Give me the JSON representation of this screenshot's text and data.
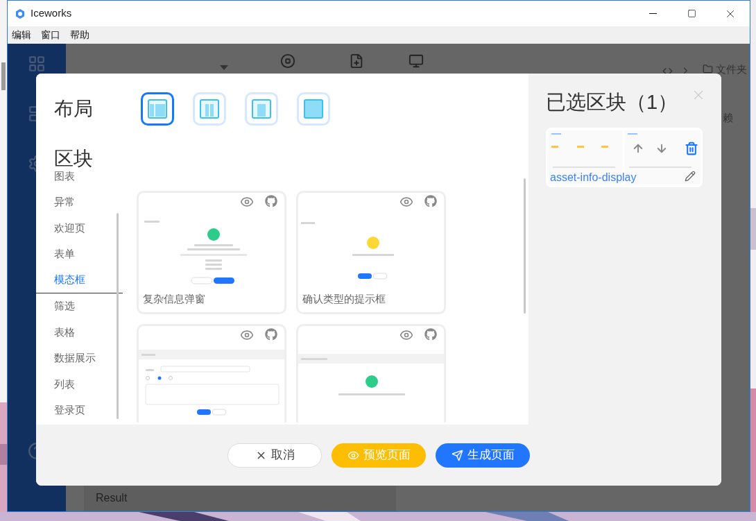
{
  "window": {
    "title": "Iceworks"
  },
  "menu": [
    "编辑",
    "窗口",
    "帮助"
  ],
  "background_app": {
    "sidebar": [
      {
        "kind": "grid"
      },
      {
        "kind": "template"
      },
      {
        "kind": "gear"
      },
      {
        "kind": "help"
      }
    ],
    "tools": [
      {
        "kind": "code"
      },
      {
        "kind": "terminal"
      },
      {
        "kind": "folder",
        "label": "文件夹"
      }
    ],
    "side_text": "赖",
    "result": "Result"
  },
  "dialog": {
    "layout_title": "布局",
    "layouts": [
      {
        "kind": "sidebar-left",
        "selected": true
      },
      {
        "kind": "two-column",
        "selected": false
      },
      {
        "kind": "centered",
        "selected": false
      },
      {
        "kind": "full",
        "selected": false
      }
    ],
    "blocks_title": "区块",
    "categories": [
      {
        "label": "图表",
        "selected": false
      },
      {
        "label": "异常",
        "selected": false
      },
      {
        "label": "欢迎页",
        "selected": false
      },
      {
        "label": "表单",
        "selected": false
      },
      {
        "label": "模态框",
        "selected": true
      },
      {
        "label": "筛选",
        "selected": false
      },
      {
        "label": "表格",
        "selected": false
      },
      {
        "label": "数据展示",
        "selected": false
      },
      {
        "label": "列表",
        "selected": false
      },
      {
        "label": "登录页",
        "selected": false
      }
    ],
    "cards": [
      {
        "title": "复杂信息弹窗",
        "kind": "success"
      },
      {
        "title": "确认类型的提示框",
        "kind": "warning"
      },
      {
        "kind": "form"
      },
      {
        "kind": "submitted"
      }
    ],
    "selected_panel": {
      "title": "已选区块（1）",
      "blocks": [
        {
          "name": "asset-info-display"
        }
      ]
    },
    "buttons": [
      {
        "kind": "cancel",
        "label": "取消"
      },
      {
        "kind": "preview",
        "label": "预览页面"
      },
      {
        "kind": "generate",
        "label": "生成页面"
      }
    ]
  }
}
